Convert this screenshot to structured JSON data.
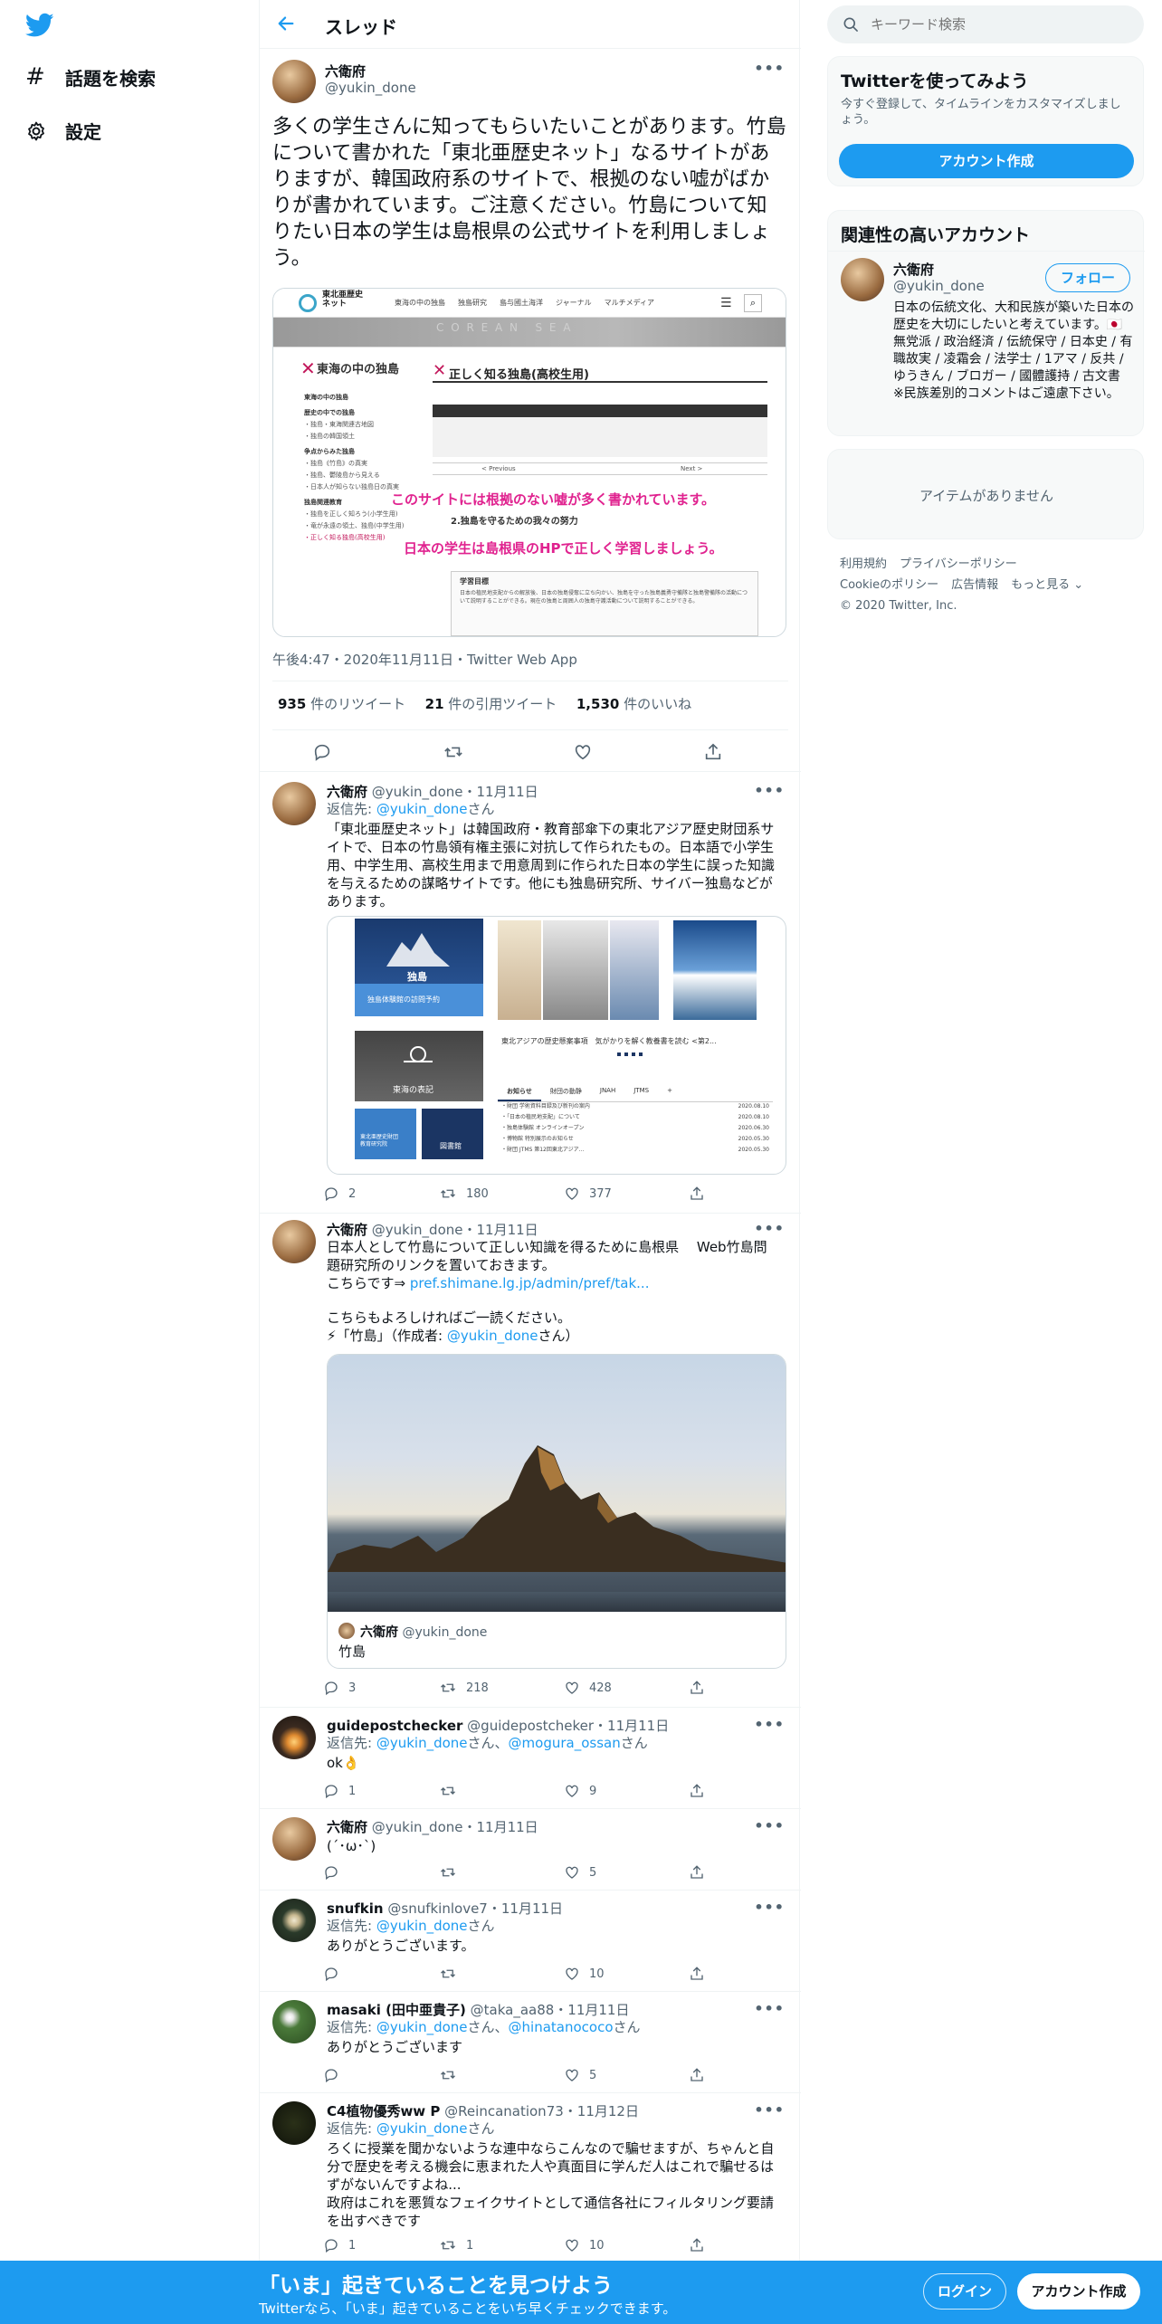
{
  "nav": {
    "explore_label": "話題を検索",
    "settings_label": "設定"
  },
  "header": {
    "title": "スレッド"
  },
  "main_tweet": {
    "name": "六衛府",
    "handle": "@yukin_done",
    "text": "多くの学生さんに知ってもらいたいことがあります。竹島について書かれた「東北亜歴史ネット」なるサイトがありますが、韓国政府系のサイトで、根拠のない嘘がばかりが書かれています。ご注意ください。竹島について知りたい日本の学生は島根県の公式サイトを利用しましょう。",
    "image": {
      "site_name": "東北亜歴史\nネット",
      "menu": [
        "東海の中の独島",
        "独島研究",
        "島与國土海洋",
        "ジャーナル",
        "マルチメディア"
      ],
      "sea_label": "C O R E A N   S E A",
      "sidebar_title": "東海の中の独島",
      "sidebar_items": [
        "東海の中の独島",
        "歴史の中での独島",
        "・独島・東海関連古地図",
        "・独島の韓国領土",
        "争点からみた独島",
        "・独島《竹島》の真実",
        "・独島、鬱陵島から見える",
        "・日本人が知らない独島日の真実",
        "独島関連教育",
        "・独島を正しく知ろう(小学生用)",
        "・竜が永遠の領土、独島(中学生用)",
        "・正しく知る独島(高校生用)"
      ],
      "page_title": "正しく知る独島(高校生用)",
      "caption1": "このサイトには根拠のない嘘が多く書かれています。",
      "subtitle": "2.独島を守るための我々の努力",
      "caption2": "日本の学生は島根県のHPで正しく学習しましょう。",
      "prev_label": "< Previous",
      "next_label": "Next >",
      "box_title": "学習目標",
      "box_text": "日本の植民地支配からの解放後、日本の独島侵奪に立ち向かい、独島を守った独島義勇守備隊と独島警備隊の活動について説明することができる。現在の独島と周囲人の独島守護活動について説明することができる。"
    },
    "meta": "午後4:47・2020年11月11日・Twitter Web App",
    "retweets_count": "935",
    "retweets_label": " 件のリツイート",
    "quotes_count": "21",
    "quotes_label": " 件の引用ツイート",
    "likes_count": "1,530",
    "likes_label": " 件のいいね"
  },
  "replies": [
    {
      "name": "六衛府",
      "handle": "@yukin_done・11月11日",
      "reply_prefix": "返信先: ",
      "reply_to": "@yukin_done",
      "reply_suffix": "さん",
      "text": "「東北亜歴史ネット」は韓国政府・教育部傘下の東北アジア歴史財団系サイトで、日本の竹島領有権主張に対抗して作られたもの。日本語で小学生用、中学生用、高校生用まで用意周到に作られた日本の学生に誤った知識を与えるための謀略サイトです。他にも独島研究所、サイバー独島などがあります。",
      "image": {
        "dokdo_label": "独島",
        "dokdo_btn": "独島体験館の訪問予約",
        "east_sea_label": "東海の表記",
        "museum_label": "東北亜歴史財団\n教育研究院",
        "library_label": "図書館",
        "banner_caption": "東北アジアの歴史懸案事項　気がかりを解く教養書を読む <第2...",
        "tabs": [
          "お知らせ",
          "財団の動静",
          "JNAH",
          "JTMS",
          "+"
        ],
        "news": [
          "・財団 学術資料目録及び新刊の案内",
          "・「日本の植民地支配」について",
          "・独島体験館 オンラインオープン",
          "・博物館 特別展示のお知らせ",
          "・財団 JTMS 第12回東北アジア..."
        ],
        "news_dates": [
          "2020.08.10",
          "2020.08.10",
          "2020.06.30",
          "2020.05.30",
          "2020.05.30"
        ]
      },
      "reply": "2",
      "retweet": "180",
      "like": "377"
    },
    {
      "name": "六衛府",
      "handle": "@yukin_done・11月11日",
      "text1": "日本人として竹島について正しい知識を得るために島根県　 Web竹島問題研究所のリンクを置いておきます。",
      "text2_prefix": "こちらです⇒ ",
      "link": "pref.shimane.lg.jp/admin/pref/tak...",
      "text3": "こちらもよろしければご一読ください。",
      "text4_prefix": "⚡「竹島」（作成者: ",
      "text4_link": "@yukin_done",
      "text4_suffix": "さん）",
      "card_name": "六衛府",
      "card_handle": "@yukin_done",
      "card_title": "竹島",
      "reply": "3",
      "retweet": "218",
      "like": "428"
    },
    {
      "name": "guidepostchecker",
      "handle": "@guidepostcheker・11月11日",
      "reply_prefix": "返信先: ",
      "reply_to": "@yukin_done",
      "reply_mid": "さん、",
      "reply_to2": "@mogura_ossan",
      "reply_suffix": "さん",
      "text": "ok👌",
      "reply": "1",
      "retweet": "",
      "like": "9"
    },
    {
      "name": "六衛府",
      "handle": "@yukin_done・11月11日",
      "text": "(´･ω･`)",
      "reply": "",
      "retweet": "",
      "like": "5"
    },
    {
      "name": "snufkin",
      "handle": "@snufkinlove7・11月11日",
      "reply_prefix": "返信先: ",
      "reply_to": "@yukin_done",
      "reply_suffix": "さん",
      "text": "ありがとうございます。",
      "reply": "",
      "retweet": "",
      "like": "10"
    },
    {
      "name": "masaki (田中亜貴子)",
      "handle": "@taka_aa88・11月11日",
      "reply_prefix": "返信先: ",
      "reply_to": "@yukin_done",
      "reply_mid": "さん、",
      "reply_to2": "@hinatanococo",
      "reply_suffix": "さん",
      "text": "ありがとうございます",
      "reply": "",
      "retweet": "",
      "like": "5"
    },
    {
      "name": "C4植物優秀ww P",
      "handle": "@Reincanation73・11月12日",
      "reply_prefix": "返信先: ",
      "reply_to": "@yukin_done",
      "reply_suffix": "さん",
      "text": "ろくに授業を聞かないような連中ならこんなので騙せますが、ちゃんと自分で歴史を考える機会に恵まれた人や真面目に学んだ人はこれで騙せるはずがないんですよね...\n政府はこれを悪質なフェイクサイトとして通信各社にフィルタリング要請を出すべきです",
      "reply": "1",
      "retweet": "1",
      "like": "10"
    }
  ],
  "right": {
    "search_placeholder": "キーワード検索",
    "signup_title": "Twitterを使ってみよう",
    "signup_text": "今すぐ登録して、タイムラインをカスタマイズしましょう。",
    "signup_button": "アカウント作成",
    "related_title": "関連性の高いアカウント",
    "related_name": "六衛府",
    "related_handle": "@yukin_done",
    "follow_button": "フォロー",
    "related_bio": "日本の伝統文化、大和民族が築いた日本の歴史を大切にしたいと考えています。🇯🇵 無党派 / 政治経済 / 伝統保守 / 日本史 / 有職故実 / 凌霜会 / 法学士 / 1アマ / 反共 / ゆうきん / ブロガー / 國體護持 / 古文書 ※民族差別的コメントはご遠慮下さい。",
    "trends_empty": "アイテムがありません",
    "footer_links": [
      "利用規約",
      "プライバシーポリシー",
      "Cookieのポリシー",
      "広告情報",
      "もっと見る ⌄",
      "© 2020 Twitter, Inc."
    ]
  },
  "bottom": {
    "title": "「いま」起きていることを見つけよう",
    "subtitle": "Twitterなら、「いま」起きていることをいち早くチェックできます。",
    "login": "ログイン",
    "signup": "アカウント作成"
  }
}
